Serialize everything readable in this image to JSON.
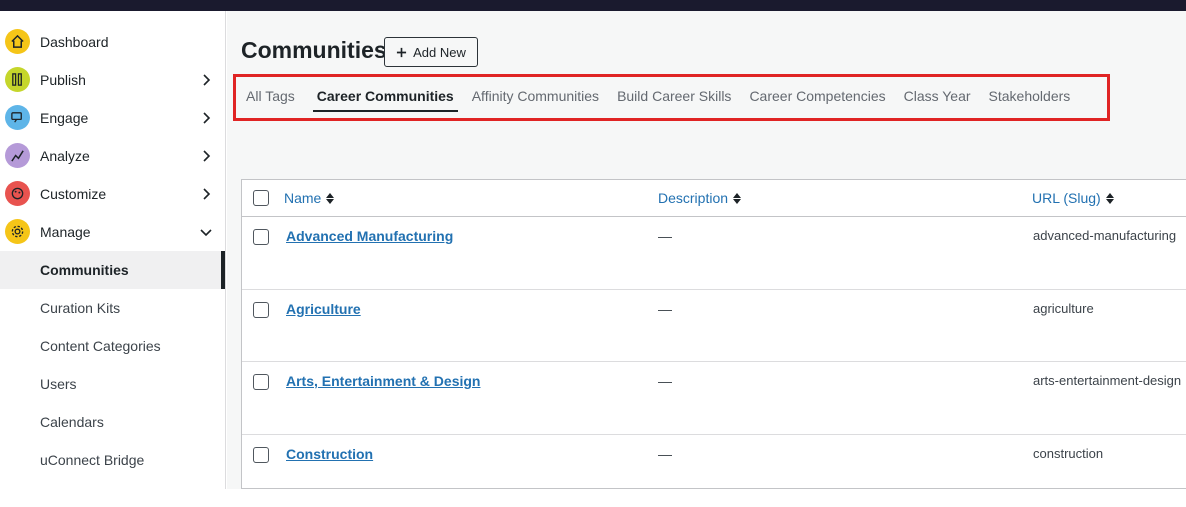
{
  "sidebar": {
    "items": [
      {
        "label": "Dashboard",
        "icon": "home-icon",
        "color": "#f5c518",
        "chevron": ""
      },
      {
        "label": "Publish",
        "icon": "pencil-icon",
        "color": "#c5d62b",
        "chevron": "right"
      },
      {
        "label": "Engage",
        "icon": "chat-icon",
        "color": "#5eb5e8",
        "chevron": "right"
      },
      {
        "label": "Analyze",
        "icon": "chart-icon",
        "color": "#b59ad8",
        "chevron": "right"
      },
      {
        "label": "Customize",
        "icon": "palette-icon",
        "color": "#e8534f",
        "chevron": "right"
      },
      {
        "label": "Manage",
        "icon": "gear-icon",
        "color": "#f5c518",
        "chevron": "down"
      }
    ],
    "sub_items": [
      "Communities",
      "Curation Kits",
      "Content Categories",
      "Users",
      "Calendars",
      "uConnect Bridge"
    ]
  },
  "header": {
    "title": "Communities",
    "add_new": "Add New"
  },
  "tabs": [
    "All Tags",
    "Career Communities",
    "Affinity Communities",
    "Build Career Skills",
    "Career Competencies",
    "Class Year",
    "Stakeholders"
  ],
  "table": {
    "columns": [
      "Name",
      "Description",
      "URL (Slug)"
    ],
    "rows": [
      {
        "name": "Advanced Manufacturing",
        "description": "—",
        "slug": "advanced-manufacturing"
      },
      {
        "name": "Agriculture",
        "description": "—",
        "slug": "agriculture"
      },
      {
        "name": "Arts, Entertainment & Design",
        "description": "—",
        "slug": "arts-entertainment-design"
      },
      {
        "name": "Construction",
        "description": "—",
        "slug": "construction"
      }
    ]
  }
}
